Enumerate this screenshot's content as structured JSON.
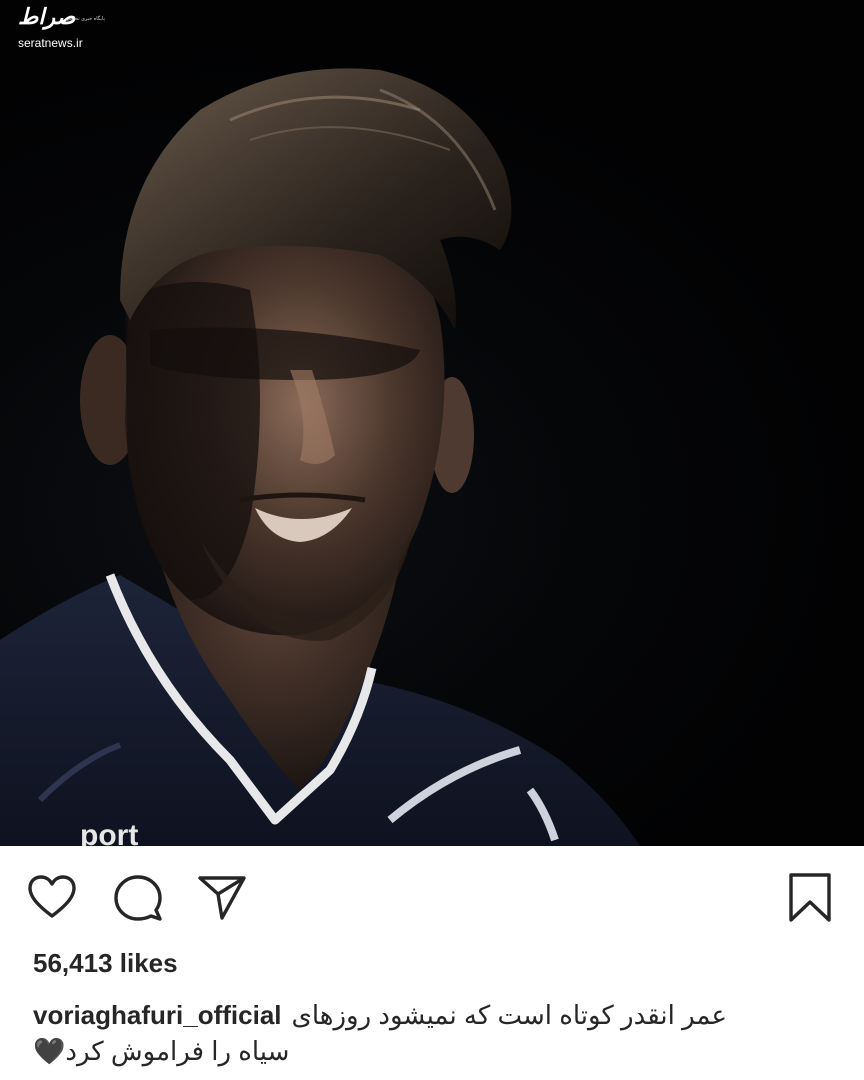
{
  "post": {
    "image_alt": "Portrait of smiling footballer in dark kit",
    "jersey_text": "port"
  },
  "watermark": {
    "logo": "صراط",
    "tagline": "پایگاه خبری تحلیلی",
    "site": "seratnews.ir"
  },
  "actions": {
    "like": "heart-icon",
    "comment": "comment-icon",
    "share": "send-icon",
    "save": "bookmark-icon"
  },
  "likes": {
    "text": "56,413 likes"
  },
  "caption": {
    "username": "voriaghafuri_official",
    "line1": "عمر انقدر کوتاه است که نمیشود روزهای",
    "line2": "سیاه را فراموش کرد🖤"
  }
}
